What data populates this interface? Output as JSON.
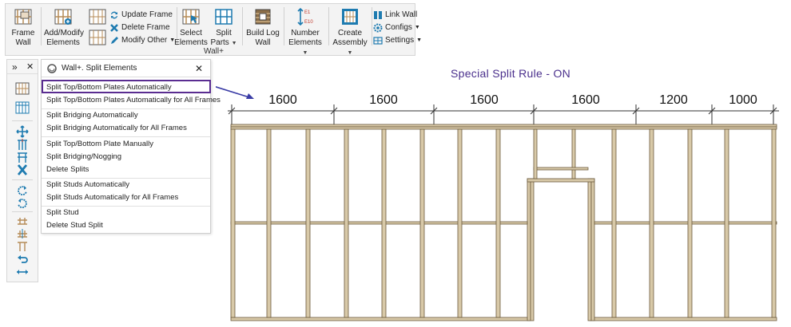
{
  "ribbon": {
    "frame_wall": "Frame Wall",
    "add_modify": "Add/Modify Elements",
    "update_frame": "Update Frame",
    "delete_frame": "Delete Frame",
    "modify_other": "Modify Other",
    "select_elements": "Select Elements",
    "split_parts": "Split Parts",
    "build_log_wall": "Build Log Wall",
    "number_elements": "Number Elements",
    "create_assembly": "Create Assembly",
    "link_wall": "Link Wall",
    "configs": "Configs",
    "settings": "Settings",
    "group_label": "Wall+",
    "accent_color": "#1e7bb0"
  },
  "sidebar": {
    "expand_glyph": "»",
    "close_glyph": "✕"
  },
  "panel": {
    "title": "Wall+. Split Elements",
    "close_glyph": "✕",
    "items": [
      "Split Top/Bottom Plates Automatically",
      "Split Top/Bottom Plates Automatically for All Frames",
      "Split Bridging Automatically",
      "Split Bridging Automatically for All Frames",
      "Split Top/Bottom Plate Manually",
      "Split Bridging/Nogging",
      "Delete Splits",
      "Split Studs Automatically",
      "Split Studs Automatically for All Frames",
      "Split Stud",
      "Delete Stud Split"
    ],
    "highlight_color": "#5a2d91"
  },
  "drawing": {
    "rule_title": "Special Split Rule - ON",
    "dimensions": [
      "1600",
      "1600",
      "1600",
      "1600",
      "1200",
      "1000"
    ],
    "timber_color": "#d8c9a8",
    "timber_edge": "#6b5a3d"
  }
}
